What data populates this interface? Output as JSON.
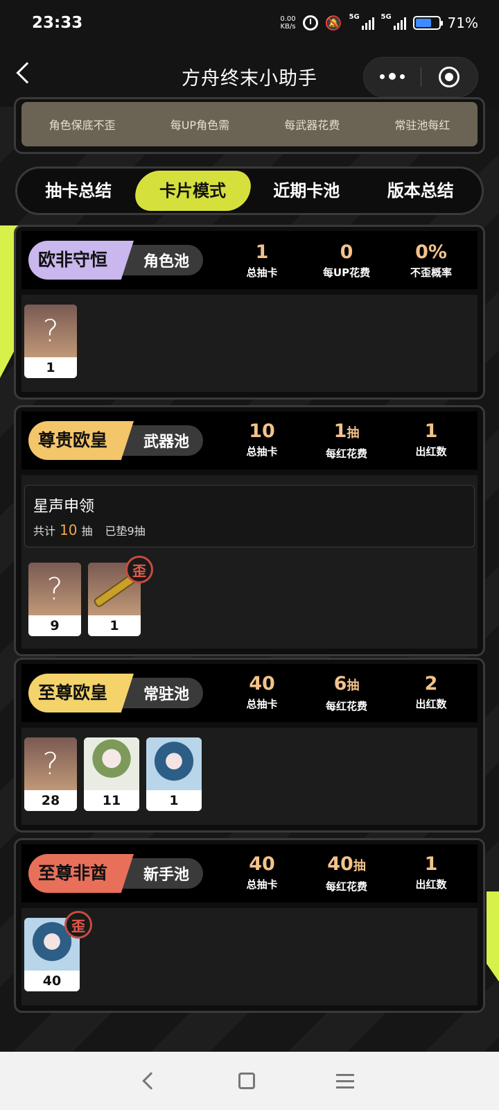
{
  "status_bar": {
    "time": "23:33",
    "net_speed_value": "0.00",
    "net_speed_unit": "KB/s",
    "signal1_label": "5G",
    "signal2_label": "5G",
    "battery_pct": "71%",
    "battery_level": 0.71
  },
  "nav": {
    "title": "方舟终末小助手"
  },
  "top_card": {
    "labels": [
      "角色保底不歪",
      "每UP角色需",
      "每武器花费",
      "常驻池每红"
    ]
  },
  "tabs": [
    "抽卡总结",
    "卡片模式",
    "近期卡池",
    "版本总结"
  ],
  "active_tab": 1,
  "colors": {
    "accent_yellow": "#d6e03c",
    "stat_gold": "#f2c38a",
    "wai_red": "#c94b40"
  },
  "cards": [
    {
      "rank": "欧非守恒",
      "rank_color": "#c9b7ee",
      "pool": "角色池",
      "stats": [
        {
          "value": "1",
          "unit": "",
          "label": "总抽卡"
        },
        {
          "value": "0",
          "unit": "",
          "label": "每UP花费"
        },
        {
          "value": "0%",
          "unit": "",
          "label": "不歪概率"
        }
      ],
      "items": [
        {
          "type": "unknown",
          "glyph": "?",
          "count": "1"
        }
      ]
    },
    {
      "rank": "尊贵欧皇",
      "rank_color": "#f3c66a",
      "pool": "武器池",
      "stats": [
        {
          "value": "10",
          "unit": "",
          "label": "总抽卡"
        },
        {
          "value": "1",
          "unit": "抽",
          "label": "每红花费"
        },
        {
          "value": "1",
          "unit": "",
          "label": "出红数"
        }
      ],
      "banner": {
        "name": "星声申领",
        "total_prefix": "共计",
        "total_num": "10",
        "total_suffix": "抽",
        "pity": "已垫9抽"
      },
      "items": [
        {
          "type": "unknown",
          "glyph": "?",
          "count": "9"
        },
        {
          "type": "weapon",
          "count": "1",
          "wai": "歪"
        }
      ]
    },
    {
      "rank": "至尊欧皇",
      "rank_color": "#f3d36a",
      "pool": "常驻池",
      "stats": [
        {
          "value": "40",
          "unit": "",
          "label": "总抽卡"
        },
        {
          "value": "6",
          "unit": "抽",
          "label": "每红花费"
        },
        {
          "value": "2",
          "unit": "",
          "label": "出红数"
        }
      ],
      "items": [
        {
          "type": "unknown",
          "glyph": "?",
          "count": "28"
        },
        {
          "type": "char-green",
          "count": "11"
        },
        {
          "type": "char-blue",
          "count": "1"
        }
      ]
    },
    {
      "rank": "至尊非酋",
      "rank_color": "#e8705a",
      "pool": "新手池",
      "stats": [
        {
          "value": "40",
          "unit": "",
          "label": "总抽卡"
        },
        {
          "value": "40",
          "unit": "抽",
          "label": "每红花费"
        },
        {
          "value": "1",
          "unit": "",
          "label": "出红数"
        }
      ],
      "items": [
        {
          "type": "char-blue",
          "count": "40",
          "wai": "歪"
        }
      ]
    }
  ]
}
